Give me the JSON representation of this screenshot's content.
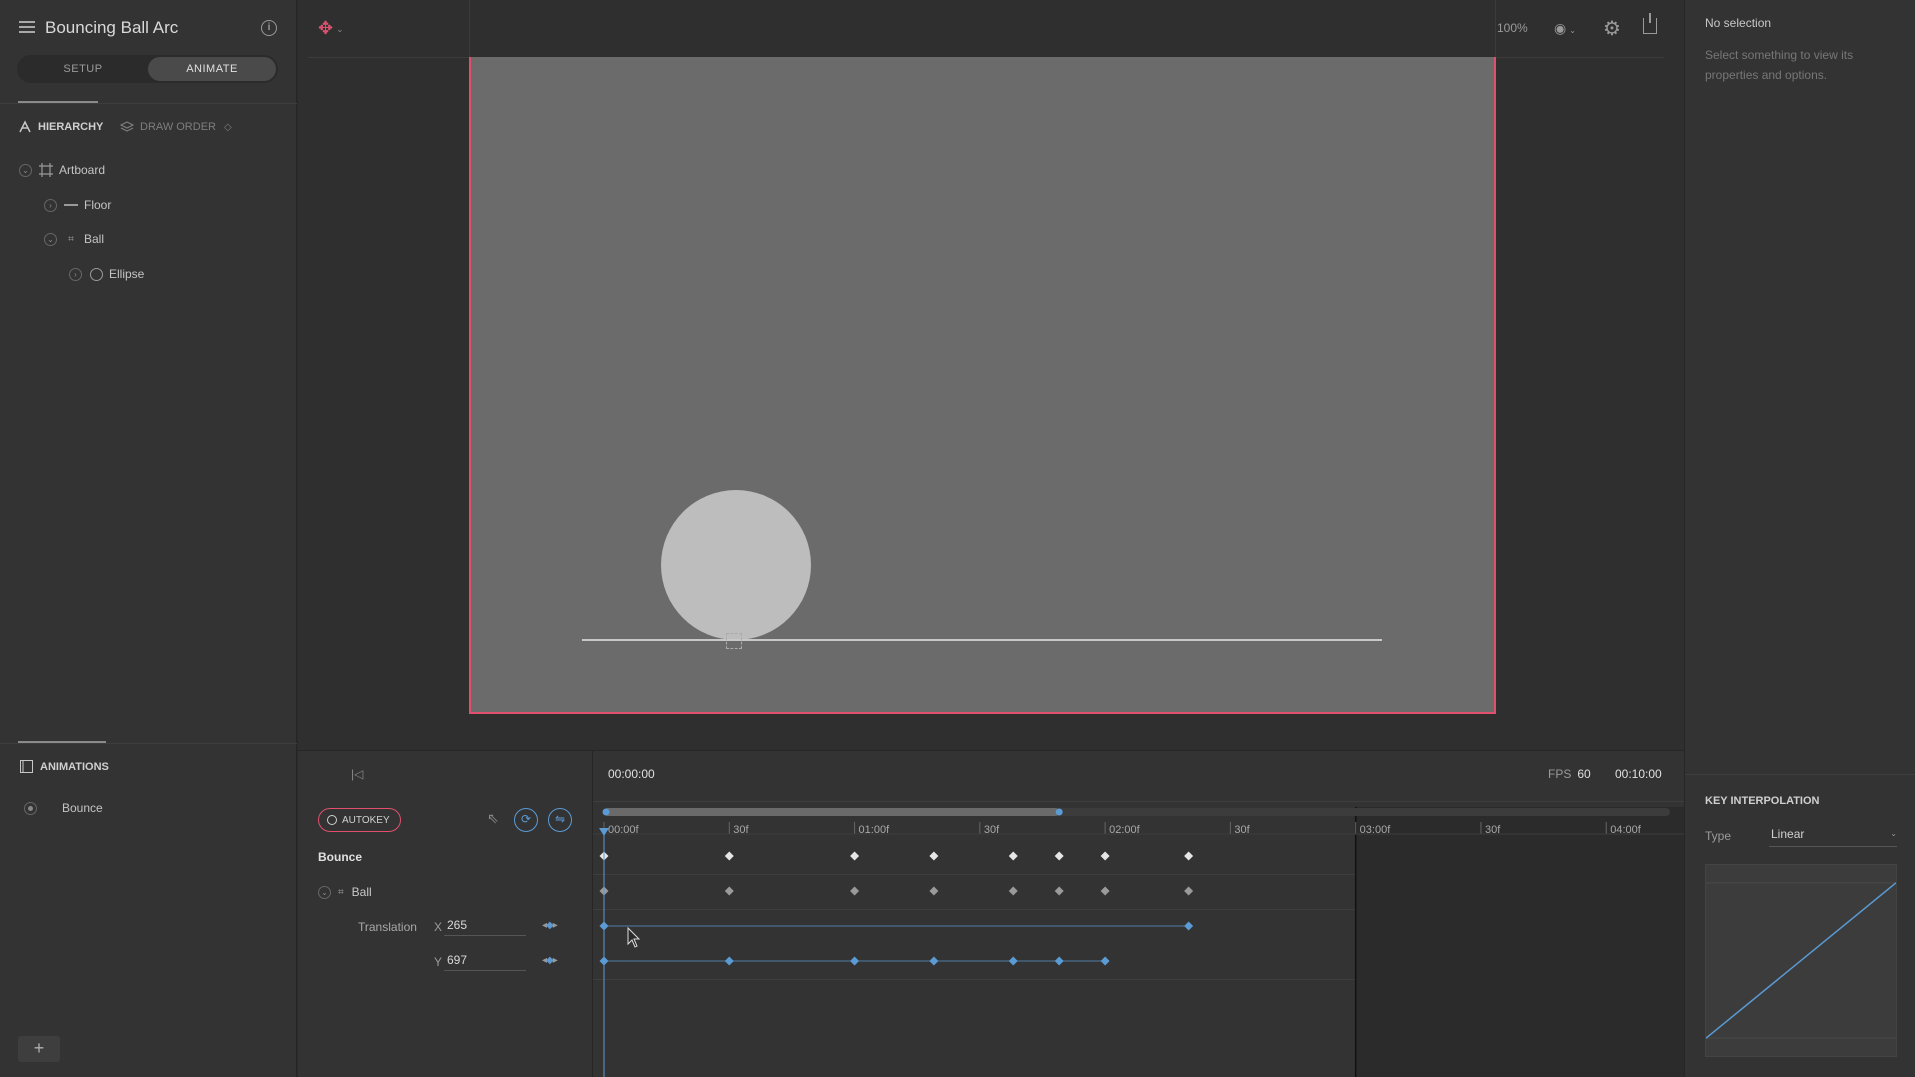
{
  "app": {
    "title": "Bouncing Ball Arc",
    "mode_setup": "SETUP",
    "mode_animate": "ANIMATE"
  },
  "hierarchy": {
    "tab_hierarchy": "HIERARCHY",
    "tab_draw_order": "DRAW ORDER",
    "nodes": [
      {
        "label": "Artboard"
      },
      {
        "label": "Floor"
      },
      {
        "label": "Ball"
      },
      {
        "label": "Ellipse"
      }
    ]
  },
  "animations": {
    "header": "ANIMATIONS",
    "items": [
      {
        "label": "Bounce"
      }
    ]
  },
  "stage": {
    "zoom": "100%"
  },
  "inspector": {
    "title": "No selection",
    "description": "Select something to view its properties and options.",
    "key_interpolation": "KEY INTERPOLATION",
    "type_label": "Type",
    "type_value": "Linear"
  },
  "timeline": {
    "current_time": "00:00:00",
    "fps_label": "FPS",
    "fps_value": "60",
    "duration": "00:10:00",
    "autokey": "AUTOKEY",
    "animation_name": "Bounce",
    "object": "Ball",
    "property": "Translation",
    "x_label": "X",
    "x_value": "265",
    "y_label": "Y",
    "y_value": "697",
    "ticks": [
      {
        "label": "00:00f",
        "frame": 0
      },
      {
        "label": "30f",
        "frame": 30
      },
      {
        "label": "01:00f",
        "frame": 60
      },
      {
        "label": "30f",
        "frame": 90
      },
      {
        "label": "02:00f",
        "frame": 120
      },
      {
        "label": "30f",
        "frame": 150
      },
      {
        "label": "03:00f",
        "frame": 180
      },
      {
        "label": "30f",
        "frame": 210
      },
      {
        "label": "04:00f",
        "frame": 240
      }
    ],
    "work_area_end_frame": 180,
    "playrange_end_frame": 109,
    "keyframes_all": [
      0,
      30,
      60,
      79,
      98,
      109,
      120,
      140
    ],
    "keyframes_x": [
      0,
      140
    ],
    "keyframes_y": [
      0,
      30,
      60,
      79,
      98,
      109,
      120
    ]
  },
  "colors": {
    "accent": "#e0506e",
    "key_blue": "#5b9bd5"
  }
}
